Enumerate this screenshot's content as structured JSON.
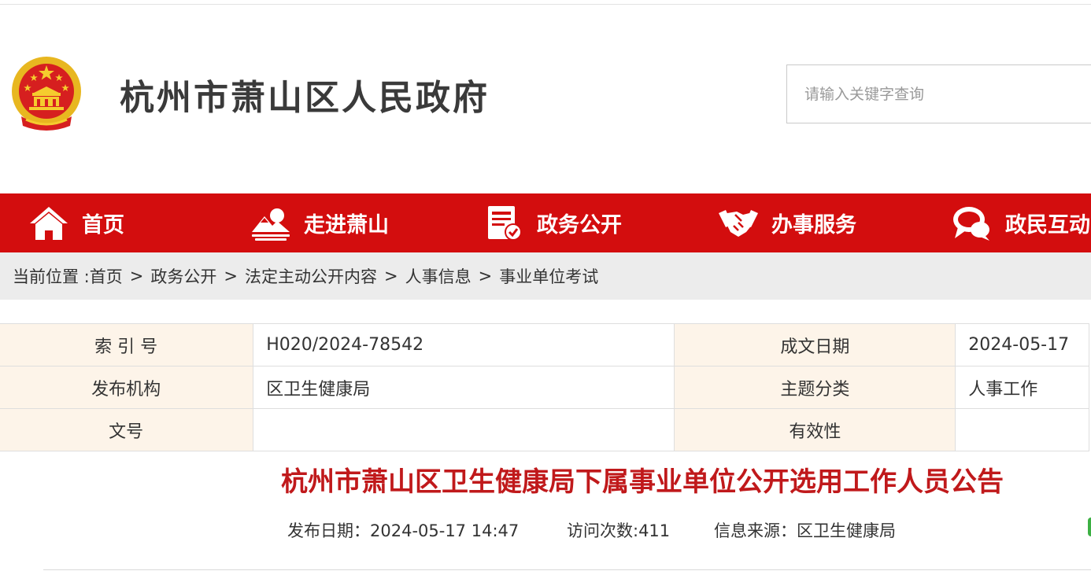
{
  "header": {
    "site_title": "杭州市萧山区人民政府",
    "search": {
      "placeholder": "请输入关键字查询",
      "value": ""
    }
  },
  "nav": {
    "items": [
      {
        "label": "首页",
        "icon": "home-icon"
      },
      {
        "label": "走进萧山",
        "icon": "landscape-icon"
      },
      {
        "label": "政务公开",
        "icon": "document-check-icon"
      },
      {
        "label": "办事服务",
        "icon": "handshake-icon"
      },
      {
        "label": "政民互动",
        "icon": "chat-bubble-icon"
      }
    ]
  },
  "breadcrumb": {
    "prefix": "当前位置 :",
    "separator": ">",
    "items": [
      "首页",
      "政务公开",
      "法定主动公开内容",
      "人事信息",
      "事业单位考试"
    ]
  },
  "meta": {
    "rows": [
      {
        "k1": "索 引 号",
        "v1": "H020/2024-78542",
        "k2": "成文日期",
        "v2": "2024-05-17"
      },
      {
        "k1": "发布机构",
        "v1": "区卫生健康局",
        "k2": "主题分类",
        "v2": "人事工作"
      },
      {
        "k1": "文号",
        "v1": "",
        "k2": "有效性",
        "v2": ""
      }
    ]
  },
  "article": {
    "title": "杭州市萧山区卫生健康局下属事业单位公开选用工作人员公告",
    "publish": "发布日期：2024-05-17 14:47",
    "visits": "访问次数:411",
    "source": "信息来源：区卫生健康局"
  },
  "colors": {
    "nav_red": "#d30d0e",
    "title_red": "#c0191b",
    "key_cell_bg": "#fdf4e9",
    "breadcrumb_bg": "#ececec"
  }
}
